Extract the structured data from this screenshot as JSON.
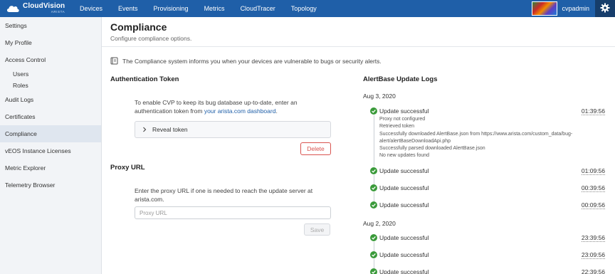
{
  "brand": {
    "name": "CloudVision",
    "sub": "ARISTA"
  },
  "nav": {
    "items": [
      "Devices",
      "Events",
      "Provisioning",
      "Metrics",
      "CloudTracer",
      "Topology"
    ]
  },
  "user": {
    "name": "cvpadmin"
  },
  "sidebar": {
    "items": [
      {
        "label": "Settings"
      },
      {
        "label": "My Profile"
      },
      {
        "label": "Access Control"
      },
      {
        "label": "Users"
      },
      {
        "label": "Roles"
      },
      {
        "label": "Audit Logs"
      },
      {
        "label": "Certificates"
      },
      {
        "label": "Compliance"
      },
      {
        "label": "vEOS Instance Licenses"
      },
      {
        "label": "Metric Explorer"
      },
      {
        "label": "Telemetry Browser"
      }
    ]
  },
  "page": {
    "title": "Compliance",
    "subtitle": "Configure compliance options.",
    "info": "The Compliance system informs you when your devices are vulnerable to bugs or security alerts."
  },
  "auth": {
    "title": "Authentication Token",
    "desc_line1": "To enable CVP to keep its bug database up-to-date, enter an",
    "desc_line2_prefix": "authentication token from ",
    "desc_link": "your arista.com dashboard",
    "desc_line2_suffix": ".",
    "reveal_label": "Reveal token",
    "delete_label": "Delete"
  },
  "proxy": {
    "title": "Proxy URL",
    "desc_line1": "Enter the proxy URL if one is needed to reach the update server at",
    "desc_line2": "arista.com.",
    "placeholder": "Proxy URL",
    "save_label": "Save"
  },
  "logs": {
    "title": "AlertBase Update Logs",
    "groups": [
      {
        "date": "Aug 3, 2020",
        "entries": [
          {
            "status": "Update successful",
            "time": "01:39:56",
            "details": [
              "Proxy not configured",
              "Retrieved token",
              "Successfully downloaded AlertBase.json from https://www.arista.com/custom_data/bug-",
              "alert/alertBaseDownloadApi.php",
              "Successfully parsed downloaded AlertBase.json",
              "No new updates found"
            ]
          },
          {
            "status": "Update successful",
            "time": "01:09:56"
          },
          {
            "status": "Update successful",
            "time": "00:39:56"
          },
          {
            "status": "Update successful",
            "time": "00:09:56"
          }
        ]
      },
      {
        "date": "Aug 2, 2020",
        "entries": [
          {
            "status": "Update successful",
            "time": "23:39:56"
          },
          {
            "status": "Update successful",
            "time": "23:09:56"
          },
          {
            "status": "Update successful",
            "time": "22:39:56"
          }
        ]
      }
    ]
  },
  "colors": {
    "nav": "#1f5fa8",
    "success": "#3a9a3a",
    "danger": "#d9534f",
    "link": "#1f5fa8"
  }
}
